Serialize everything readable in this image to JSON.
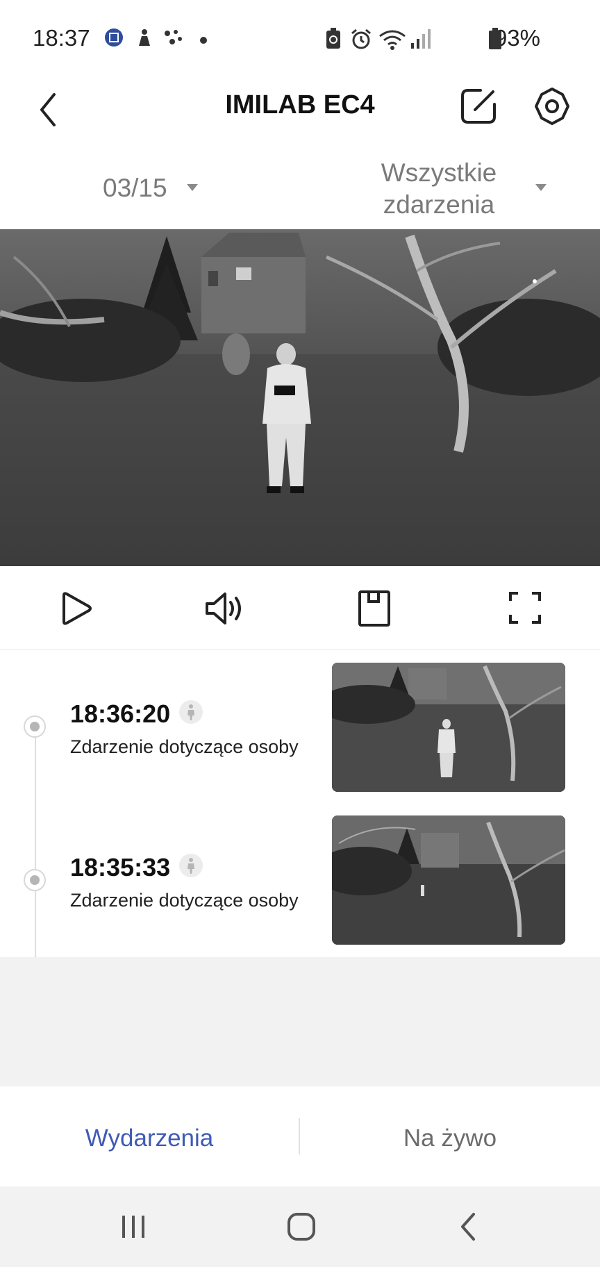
{
  "status_bar": {
    "time": "18:37",
    "battery": "93%",
    "icons": [
      "notification-badge-icon",
      "figure-icon",
      "assistant-dots-icon",
      "dot-icon",
      "battery-saver-icon",
      "alarm-icon",
      "wifi-icon",
      "signal-icon",
      "battery-icon"
    ]
  },
  "header": {
    "title": "IMILAB EC4",
    "back_icon": "back-chevron-icon",
    "edit_icon": "edit-icon",
    "settings_icon": "gear-icon"
  },
  "filters": {
    "date": "03/15",
    "events_line1": "Wszystkie",
    "events_line2": "zdarzenia"
  },
  "controls": [
    "play-icon",
    "volume-icon",
    "sd-card-icon",
    "fullscreen-icon"
  ],
  "events": [
    {
      "time": "18:36:20",
      "description": "Zdarzenie dotyczące osoby",
      "type_icon": "person-icon"
    },
    {
      "time": "18:35:33",
      "description": "Zdarzenie dotyczące osoby",
      "type_icon": "person-icon"
    }
  ],
  "tabs": {
    "events": "Wydarzenia",
    "live": "Na żywo"
  },
  "colors": {
    "accent": "#3f5bb5",
    "muted": "#7a7a7a",
    "inactive_tab": "#6b6b6b"
  },
  "navbar": [
    "recent-apps-icon",
    "home-icon",
    "back-icon"
  ]
}
